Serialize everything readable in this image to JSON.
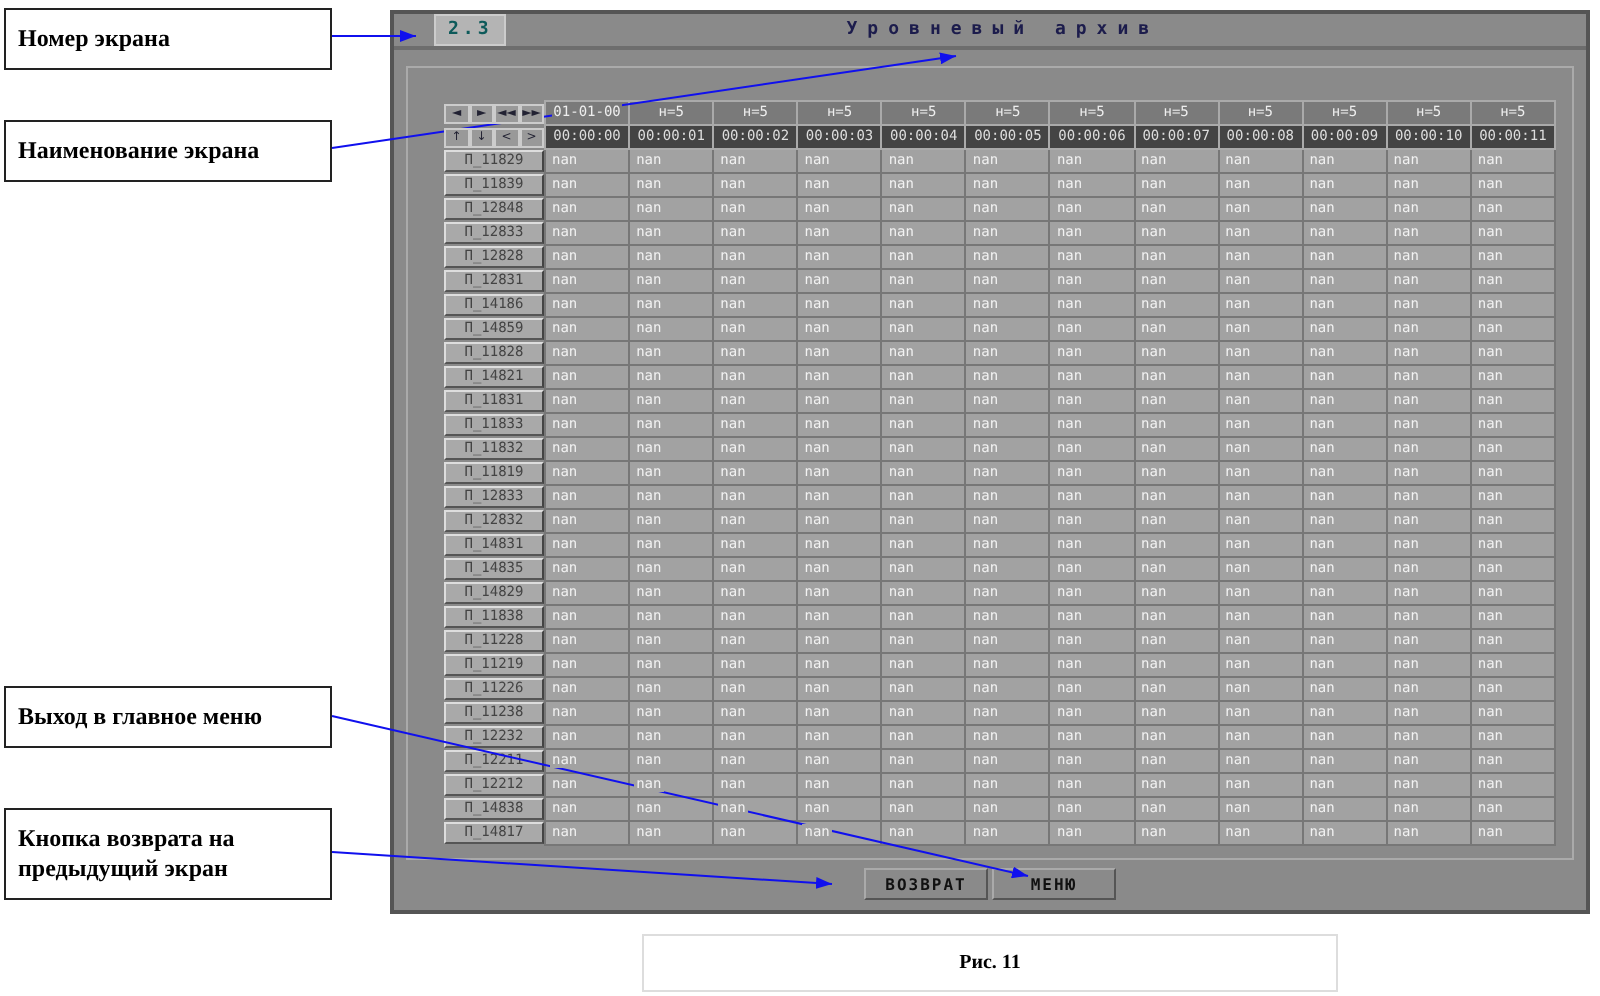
{
  "callouts": [
    {
      "text": "Номер экрана"
    },
    {
      "text": "Наименование экрана"
    },
    {
      "text": "Выход в главное меню"
    },
    {
      "text": "Кнопка возврата на предыдущий экран"
    }
  ],
  "screen": {
    "number": "2.3",
    "title": "Уровневый архив",
    "nav_buttons": [
      [
        "◄",
        "►",
        "◄◄",
        "►►"
      ],
      [
        "↑",
        "↓",
        "<",
        ">"
      ]
    ],
    "columns": [
      {
        "top": "01-01-00",
        "bottom": "00:00:00"
      },
      {
        "top": "н=5",
        "bottom": "00:00:01"
      },
      {
        "top": "н=5",
        "bottom": "00:00:02"
      },
      {
        "top": "н=5",
        "bottom": "00:00:03"
      },
      {
        "top": "н=5",
        "bottom": "00:00:04"
      },
      {
        "top": "н=5",
        "bottom": "00:00:05"
      },
      {
        "top": "н=5",
        "bottom": "00:00:06"
      },
      {
        "top": "н=5",
        "bottom": "00:00:07"
      },
      {
        "top": "н=5",
        "bottom": "00:00:08"
      },
      {
        "top": "н=5",
        "bottom": "00:00:09"
      },
      {
        "top": "н=5",
        "bottom": "00:00:10"
      },
      {
        "top": "н=5",
        "bottom": "00:00:11"
      }
    ],
    "rows": [
      {
        "label": "П_11829",
        "cells": [
          "nan",
          "nan",
          "nan",
          "nan",
          "nan",
          "nan",
          "nan",
          "nan",
          "nan",
          "nan",
          "nan",
          "nan"
        ]
      },
      {
        "label": "П_11839",
        "cells": [
          "nan",
          "nan",
          "nan",
          "nan",
          "nan",
          "nan",
          "nan",
          "nan",
          "nan",
          "nan",
          "nan",
          "nan"
        ]
      },
      {
        "label": "П_12848",
        "cells": [
          "nan",
          "nan",
          "nan",
          "nan",
          "nan",
          "nan",
          "nan",
          "nan",
          "nan",
          "nan",
          "nan",
          "nan"
        ]
      },
      {
        "label": "П_12833",
        "cells": [
          "nan",
          "nan",
          "nan",
          "nan",
          "nan",
          "nan",
          "nan",
          "nan",
          "nan",
          "nan",
          "nan",
          "nan"
        ]
      },
      {
        "label": "П_12828",
        "cells": [
          "nan",
          "nan",
          "nan",
          "nan",
          "nan",
          "nan",
          "nan",
          "nan",
          "nan",
          "nan",
          "nan",
          "nan"
        ]
      },
      {
        "label": "П_12831",
        "cells": [
          "nan",
          "nan",
          "nan",
          "nan",
          "nan",
          "nan",
          "nan",
          "nan",
          "nan",
          "nan",
          "nan",
          "nan"
        ]
      },
      {
        "label": "П_14186",
        "cells": [
          "nan",
          "nan",
          "nan",
          "nan",
          "nan",
          "nan",
          "nan",
          "nan",
          "nan",
          "nan",
          "nan",
          "nan"
        ]
      },
      {
        "label": "П_14859",
        "cells": [
          "nan",
          "nan",
          "nan",
          "nan",
          "nan",
          "nan",
          "nan",
          "nan",
          "nan",
          "nan",
          "nan",
          "nan"
        ]
      },
      {
        "label": "П_11828",
        "cells": [
          "nan",
          "nan",
          "nan",
          "nan",
          "nan",
          "nan",
          "nan",
          "nan",
          "nan",
          "nan",
          "nan",
          "nan"
        ]
      },
      {
        "label": "П_14821",
        "cells": [
          "nan",
          "nan",
          "nan",
          "nan",
          "nan",
          "nan",
          "nan",
          "nan",
          "nan",
          "nan",
          "nan",
          "nan"
        ]
      },
      {
        "label": "П_11831",
        "cells": [
          "nan",
          "nan",
          "nan",
          "nan",
          "nan",
          "nan",
          "nan",
          "nan",
          "nan",
          "nan",
          "nan",
          "nan"
        ]
      },
      {
        "label": "П_11833",
        "cells": [
          "nan",
          "nan",
          "nan",
          "nan",
          "nan",
          "nan",
          "nan",
          "nan",
          "nan",
          "nan",
          "nan",
          "nan"
        ]
      },
      {
        "label": "П_11832",
        "cells": [
          "nan",
          "nan",
          "nan",
          "nan",
          "nan",
          "nan",
          "nan",
          "nan",
          "nan",
          "nan",
          "nan",
          "nan"
        ]
      },
      {
        "label": "П_11819",
        "cells": [
          "nan",
          "nan",
          "nan",
          "nan",
          "nan",
          "nan",
          "nan",
          "nan",
          "nan",
          "nan",
          "nan",
          "nan"
        ]
      },
      {
        "label": "П_12833",
        "cells": [
          "nan",
          "nan",
          "nan",
          "nan",
          "nan",
          "nan",
          "nan",
          "nan",
          "nan",
          "nan",
          "nan",
          "nan"
        ]
      },
      {
        "label": "П_12832",
        "cells": [
          "nan",
          "nan",
          "nan",
          "nan",
          "nan",
          "nan",
          "nan",
          "nan",
          "nan",
          "nan",
          "nan",
          "nan"
        ]
      },
      {
        "label": "П_14831",
        "cells": [
          "nan",
          "nan",
          "nan",
          "nan",
          "nan",
          "nan",
          "nan",
          "nan",
          "nan",
          "nan",
          "nan",
          "nan"
        ]
      },
      {
        "label": "П_14835",
        "cells": [
          "nan",
          "nan",
          "nan",
          "nan",
          "nan",
          "nan",
          "nan",
          "nan",
          "nan",
          "nan",
          "nan",
          "nan"
        ]
      },
      {
        "label": "П_14829",
        "cells": [
          "nan",
          "nan",
          "nan",
          "nan",
          "nan",
          "nan",
          "nan",
          "nan",
          "nan",
          "nan",
          "nan",
          "nan"
        ]
      },
      {
        "label": "П_11838",
        "cells": [
          "nan",
          "nan",
          "nan",
          "nan",
          "nan",
          "nan",
          "nan",
          "nan",
          "nan",
          "nan",
          "nan",
          "nan"
        ]
      },
      {
        "label": "П_11228",
        "cells": [
          "nan",
          "nan",
          "nan",
          "nan",
          "nan",
          "nan",
          "nan",
          "nan",
          "nan",
          "nan",
          "nan",
          "nan"
        ]
      },
      {
        "label": "П_11219",
        "cells": [
          "nan",
          "nan",
          "nan",
          "nan",
          "nan",
          "nan",
          "nan",
          "nan",
          "nan",
          "nan",
          "nan",
          "nan"
        ]
      },
      {
        "label": "П_11226",
        "cells": [
          "nan",
          "nan",
          "nan",
          "nan",
          "nan",
          "nan",
          "nan",
          "nan",
          "nan",
          "nan",
          "nan",
          "nan"
        ]
      },
      {
        "label": "П_11238",
        "cells": [
          "nan",
          "nan",
          "nan",
          "nan",
          "nan",
          "nan",
          "nan",
          "nan",
          "nan",
          "nan",
          "nan",
          "nan"
        ]
      },
      {
        "label": "П_12232",
        "cells": [
          "nan",
          "nan",
          "nan",
          "nan",
          "nan",
          "nan",
          "nan",
          "nan",
          "nan",
          "nan",
          "nan",
          "nan"
        ]
      },
      {
        "label": "П_12211",
        "cells": [
          "nan",
          "nan",
          "nan",
          "nan",
          "nan",
          "nan",
          "nan",
          "nan",
          "nan",
          "nan",
          "nan",
          "nan"
        ]
      },
      {
        "label": "П_12212",
        "cells": [
          "nan",
          "nan",
          "nan",
          "nan",
          "nan",
          "nan",
          "nan",
          "nan",
          "nan",
          "nan",
          "nan",
          "nan"
        ]
      },
      {
        "label": "П_14838",
        "cells": [
          "nan",
          "nan",
          "nan",
          "nan",
          "nan",
          "nan",
          "nan",
          "nan",
          "nan",
          "nan",
          "nan",
          "nan"
        ]
      },
      {
        "label": "П_14817",
        "cells": [
          "nan",
          "nan",
          "nan",
          "nan",
          "nan",
          "nan",
          "nan",
          "nan",
          "nan",
          "nan",
          "nan",
          "nan"
        ]
      }
    ],
    "buttons": [
      "ВОЗВРАТ",
      "МЕНЮ"
    ]
  },
  "caption": "Рис. 11"
}
